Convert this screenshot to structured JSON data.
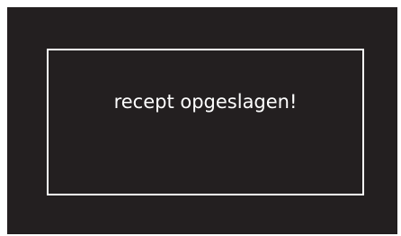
{
  "dialog": {
    "message": "recept opgeslagen!"
  },
  "colors": {
    "background": "#231f20",
    "border": "#ffffff",
    "text": "#ffffff"
  }
}
